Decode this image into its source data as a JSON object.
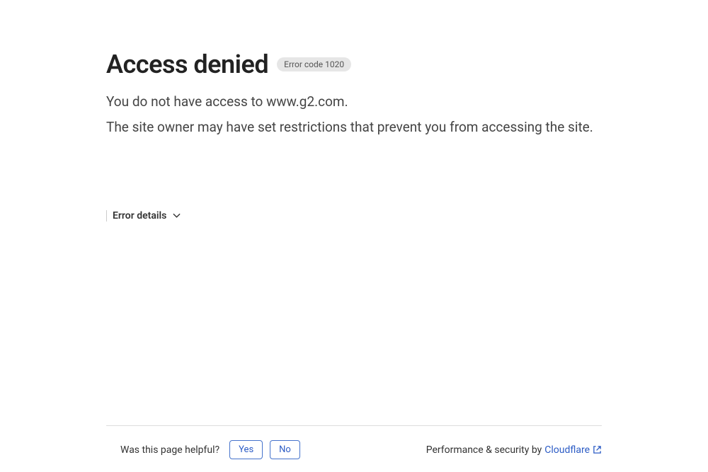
{
  "header": {
    "title": "Access denied",
    "error_badge": "Error code 1020"
  },
  "body": {
    "line1": "You do not have access to www.g2.com.",
    "line2": "The site owner may have set restrictions that prevent you from accessing the site."
  },
  "details": {
    "toggle_label": "Error details"
  },
  "footer": {
    "question": "Was this page helpful?",
    "yes_label": "Yes",
    "no_label": "No",
    "security_text": "Performance & security by",
    "provider": "Cloudflare"
  }
}
